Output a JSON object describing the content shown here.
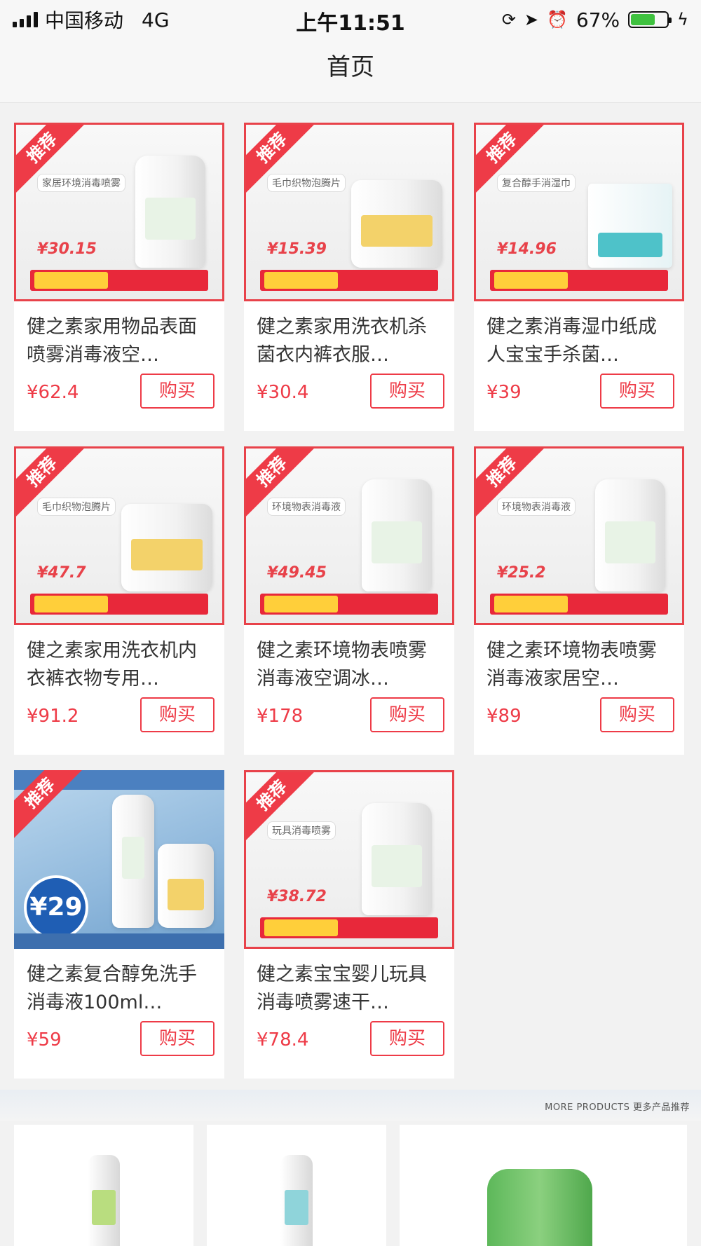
{
  "status_bar": {
    "carrier": "中国移动",
    "network": "4G",
    "time": "上午11:51",
    "battery_percent": "67%",
    "battery_level": 0.67,
    "icons": [
      "signal-icon",
      "orientation-lock-icon",
      "location-icon",
      "alarm-icon",
      "battery-icon",
      "charging-icon"
    ]
  },
  "nav": {
    "title": "首页"
  },
  "colors": {
    "accent": "#ee3b47",
    "ribbon": "#ee3b47",
    "background": "#f2f2f2"
  },
  "products": [
    {
      "badge": "推荐",
      "thumb_tag": "家居环境消毒喷雾",
      "thumb_price": "¥30.15",
      "title": "健之素家用物品表面喷雾消毒液空…",
      "price": "¥62.4",
      "buy_label": "购买"
    },
    {
      "badge": "推荐",
      "thumb_tag": "毛巾织物泡腾片",
      "thumb_price": "¥15.39",
      "title": "健之素家用洗衣机杀菌衣内裤衣服…",
      "price": "¥30.4",
      "buy_label": "购买"
    },
    {
      "badge": "推荐",
      "thumb_tag": "复合醇手消湿巾",
      "thumb_price": "¥14.96",
      "title": "健之素消毒湿巾纸成人宝宝手杀菌…",
      "price": "¥39",
      "buy_label": "购买"
    },
    {
      "badge": "推荐",
      "thumb_tag": "毛巾织物泡腾片",
      "thumb_price": "¥47.7",
      "title": "健之素家用洗衣机内衣裤衣物专用…",
      "price": "¥91.2",
      "buy_label": "购买"
    },
    {
      "badge": "推荐",
      "thumb_tag": "环境物表消毒液",
      "thumb_price": "¥49.45",
      "title": "健之素环境物表喷雾消毒液空调冰…",
      "price": "¥178",
      "buy_label": "购买"
    },
    {
      "badge": "推荐",
      "thumb_tag": "环境物表消毒液",
      "thumb_price": "¥25.2",
      "title": "健之素环境物表喷雾消毒液家居空…",
      "price": "¥89",
      "buy_label": "购买"
    },
    {
      "badge": "推荐",
      "thumb_tag": "",
      "thumb_price": "¥29",
      "title": "健之素复合醇免洗手消毒液100ml…",
      "price": "¥59",
      "buy_label": "购买"
    },
    {
      "badge": "推荐",
      "thumb_tag": "玩具消毒喷雾",
      "thumb_price": "¥38.72",
      "title": "健之素宝宝婴儿玩具消毒喷雾速干…",
      "price": "¥78.4",
      "buy_label": "购买"
    }
  ],
  "more": {
    "label": "MORE PRODUCTS 更多产品推荐"
  }
}
